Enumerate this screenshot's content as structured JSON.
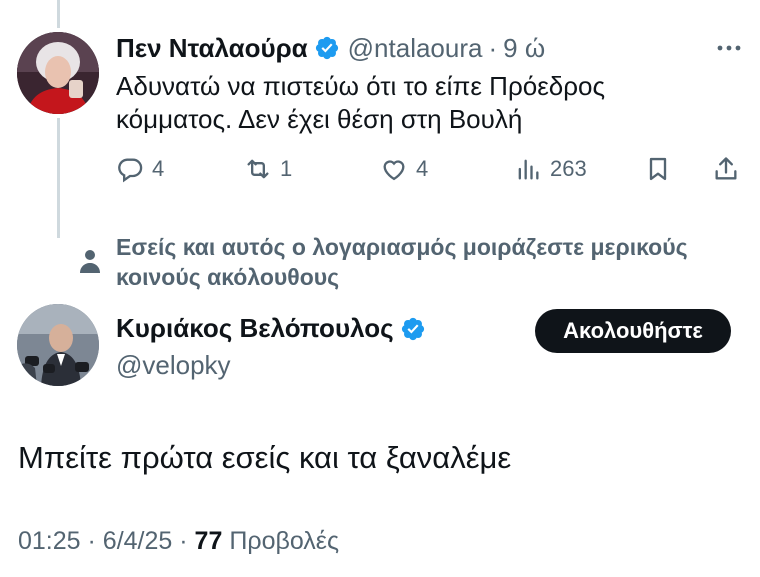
{
  "reply": {
    "name": "Πεν Νταλαούρα",
    "handle": "@ntalaoura",
    "separator": "·",
    "time": "9 ώ",
    "text_line1": "Αδυνατώ να πιστεύω ότι το είπε Πρόεδρος",
    "text_line2": "κόμματος. Δεν έχει θέση στη Βουλή",
    "replies": "4",
    "reposts": "1",
    "likes": "4",
    "views": "263",
    "more_icon": "more-horizontal-icon"
  },
  "social_context": {
    "text_line1": "Εσείς και αυτός ο λογαριασμός μοιράζεστε μερικούς",
    "text_line2": "κοινούς ακόλουθους"
  },
  "main": {
    "name": "Κυριάκος Βελόπουλος",
    "handle": "@velopky",
    "follow_label": "Ακολουθήστε",
    "text": "Μπείτε πρώτα εσείς και τα ξαναλέμε",
    "time": "01:25",
    "sep1": "·",
    "date": "6/4/25",
    "sep2": "·",
    "views_count": "77",
    "views_label": "Προβολές"
  },
  "colors": {
    "verified": "#1d9bf0",
    "muted": "#536471",
    "text": "#0f1419",
    "follow_bg": "#0f1419"
  }
}
